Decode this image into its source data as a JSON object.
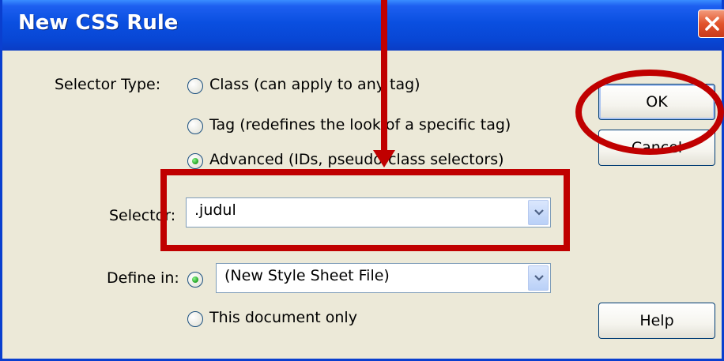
{
  "window": {
    "title": "New CSS Rule"
  },
  "selector_type": {
    "label": "Selector Type:",
    "options": [
      {
        "label": "Class (can apply to any tag)",
        "checked": false
      },
      {
        "label": "Tag (redefines the look of a specific tag)",
        "checked": false
      },
      {
        "label": "Advanced (IDs, pseudo-class selectors)",
        "checked": true
      }
    ]
  },
  "selector": {
    "label": "Selector:",
    "value": ".judul"
  },
  "define_in": {
    "label": "Define in:",
    "options": [
      {
        "label": "(New Style Sheet File)",
        "checked": true
      },
      {
        "label": "This document only",
        "checked": false
      }
    ]
  },
  "buttons": {
    "ok": "OK",
    "cancel": "Cancel",
    "help": "Help"
  },
  "icons": {
    "close": "close-icon",
    "dropdown": "chevron-down-icon"
  },
  "colors": {
    "annotation": "#c00000",
    "titlebar": "#0a4fe0"
  }
}
